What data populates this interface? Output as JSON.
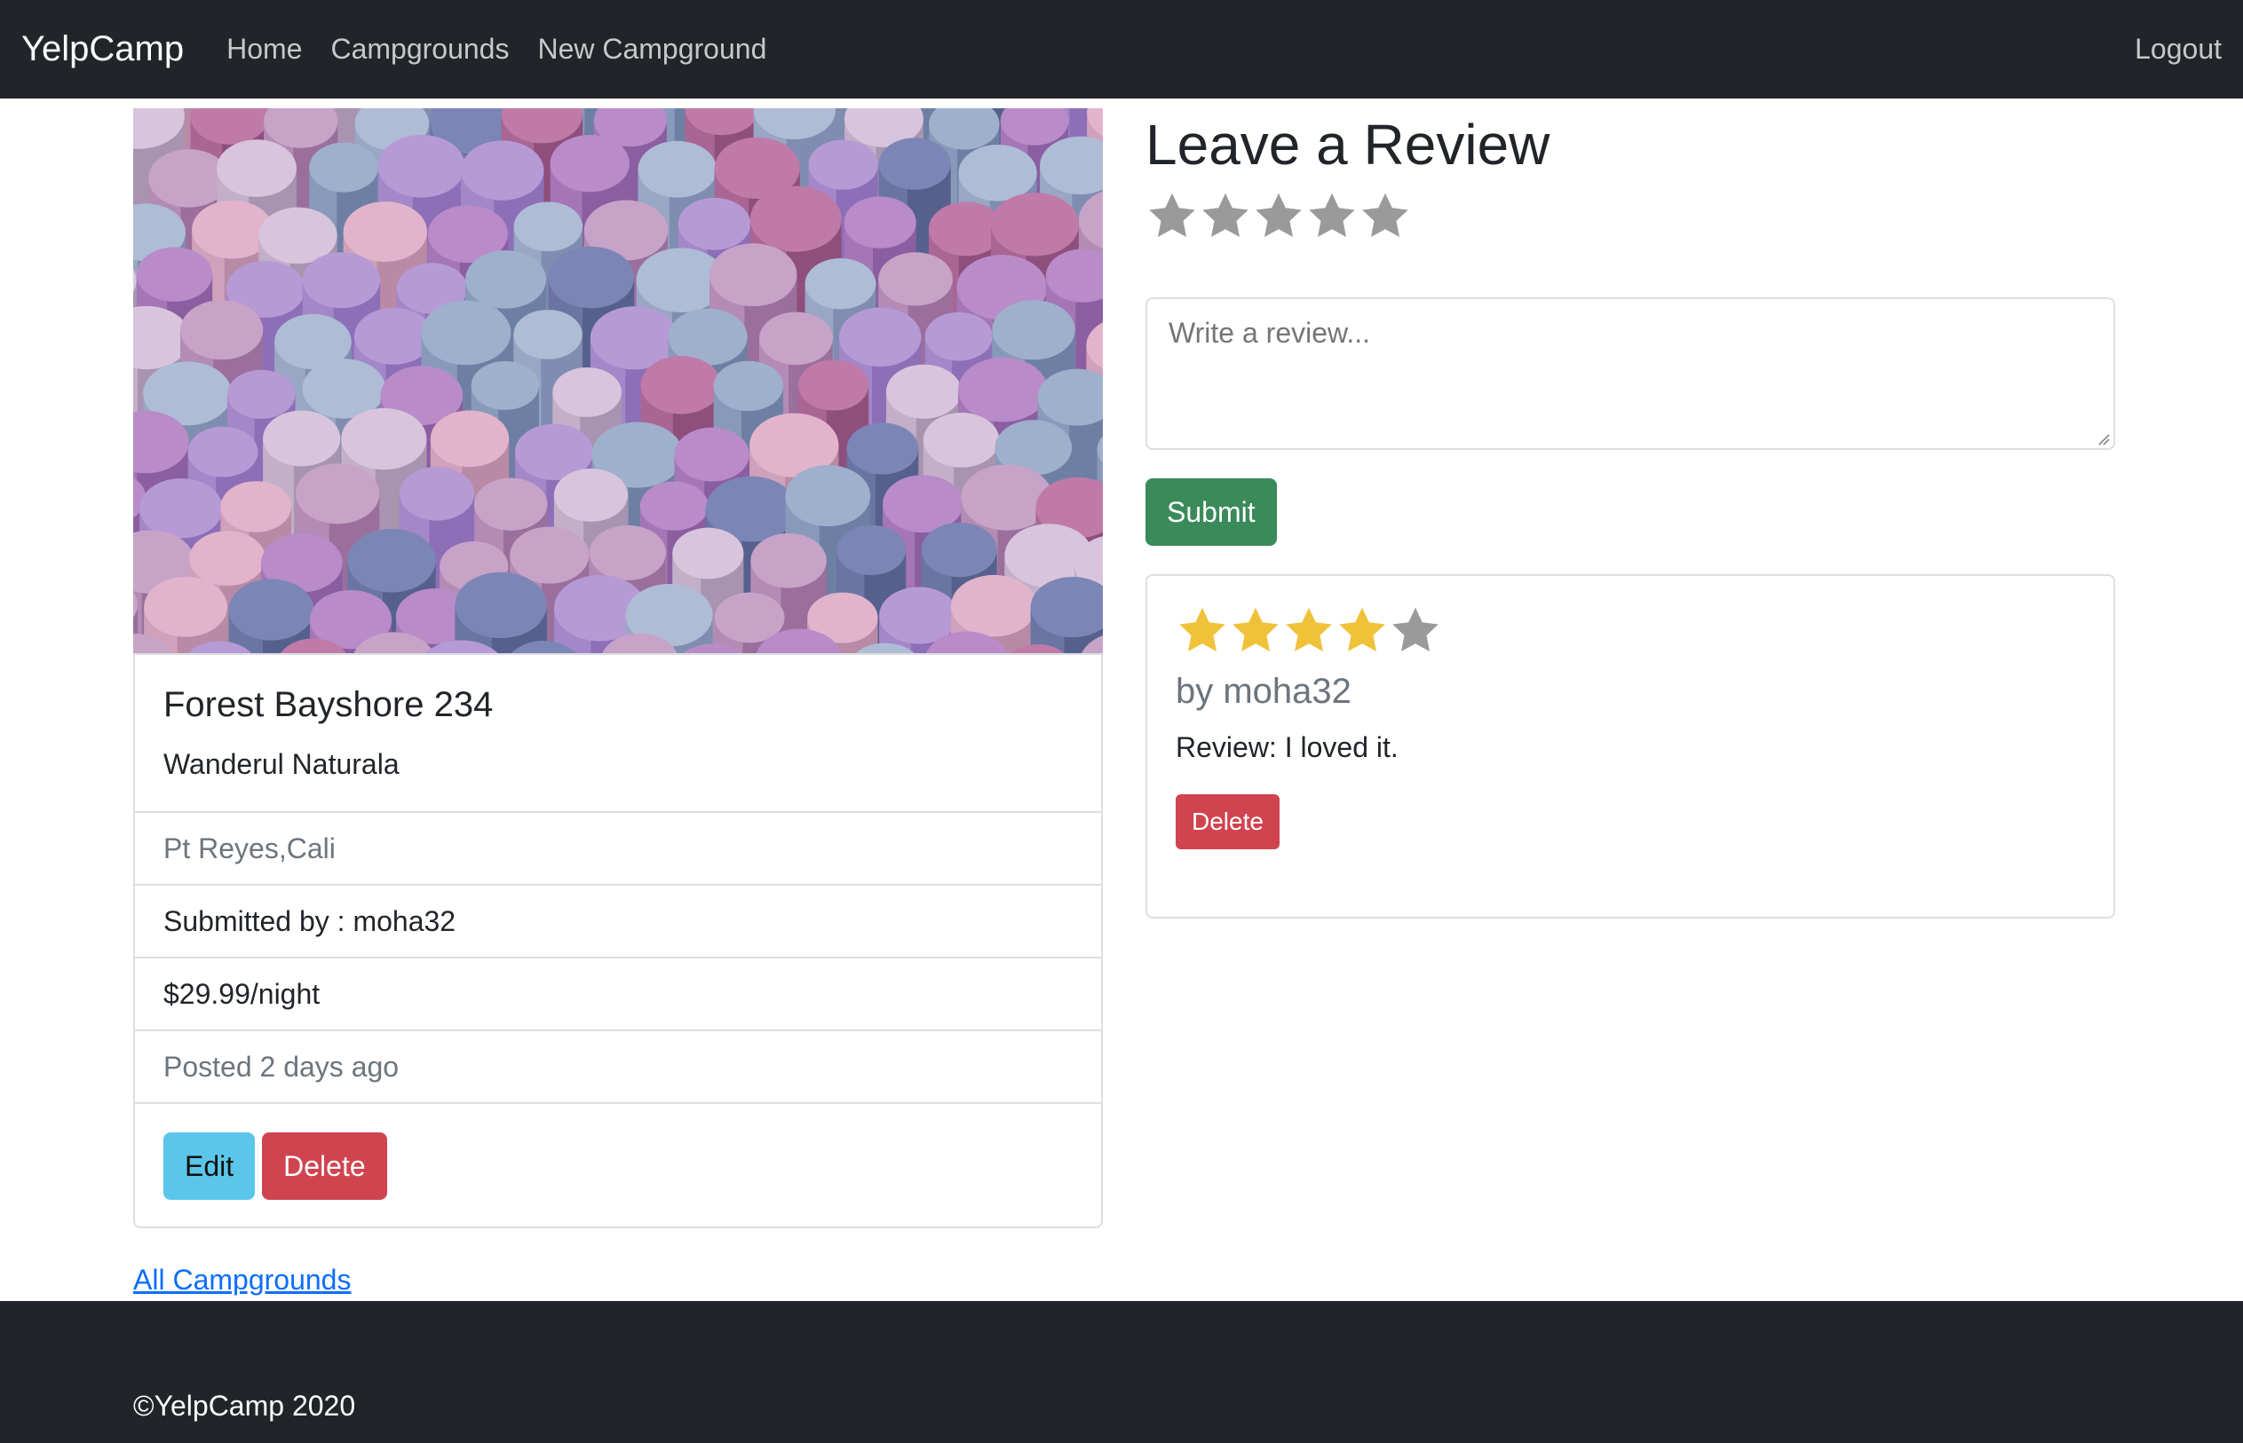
{
  "navbar": {
    "brand": "YelpCamp",
    "links": [
      "Home",
      "Campgrounds",
      "New Campground"
    ],
    "logout": "Logout"
  },
  "campground": {
    "title": "Forest Bayshore 234",
    "description": "Wanderul Naturala",
    "location": "Pt Reyes,Cali",
    "submitted_by": "Submitted by : moha32",
    "price": "$29.99/night",
    "posted": "Posted 2 days ago",
    "edit_label": "Edit",
    "delete_label": "Delete",
    "image_icon": "abstract-cylinders-image"
  },
  "all_campgrounds_link": "All Campgrounds",
  "review_form": {
    "heading": "Leave a Review",
    "star_count": 5,
    "placeholder": "Write a review...",
    "submit_label": "Submit"
  },
  "reviews": [
    {
      "rating": 4,
      "max_rating": 5,
      "author": "by moha32",
      "text": "Review: I loved it.",
      "delete_label": "Delete"
    }
  ],
  "footer": {
    "text": "©YelpCamp 2020"
  },
  "colors": {
    "navbar": "#212529",
    "star_filled": "#f0c23a",
    "star_empty": "#9a9a9a",
    "edit": "#5bc6ea",
    "delete": "#d0444f",
    "submit": "#3a8a5a",
    "link": "#0d6efd"
  }
}
